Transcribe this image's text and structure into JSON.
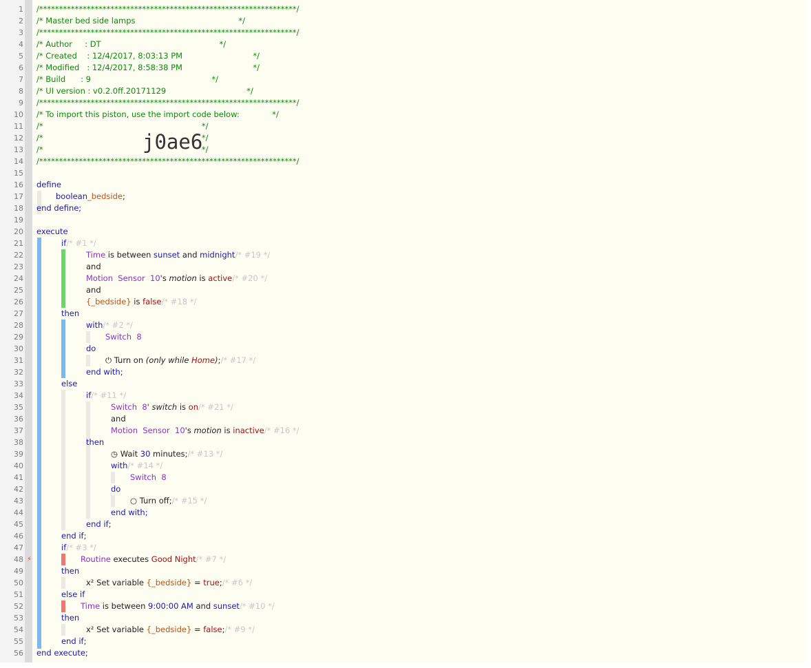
{
  "header": {
    "lines": [
      "/*****************************************************************/",
      "/* Master bed side lamps                                         */",
      "/*****************************************************************/",
      "/* Author     : DT                                               */",
      "/* Created    : 12/4/2017, 8:03:13 PM                            */",
      "/* Modified   : 12/4/2017, 8:58:38 PM                            */",
      "/* Build      : 9                                                */",
      "/* UI version : v0.2.0ff.20171129                                */",
      "/*****************************************************************/",
      "/* To import this piston, use the import code below:             */",
      "/*                                                               */",
      "/*                                                               */",
      "/*                                                               */",
      "/*****************************************************************/"
    ],
    "import_code": "j0ae6"
  },
  "line_numbers": [
    "1",
    "2",
    "3",
    "4",
    "5",
    "6",
    "7",
    "8",
    "9",
    "10",
    "11",
    "12",
    "13",
    "14",
    "15",
    "16",
    "17",
    "18",
    "19",
    "20",
    "21",
    "22",
    "23",
    "24",
    "25",
    "26",
    "27",
    "28",
    "29",
    "30",
    "31",
    "32",
    "33",
    "34",
    "35",
    "36",
    "37",
    "38",
    "39",
    "40",
    "41",
    "42",
    "43",
    "44",
    "45",
    "46",
    "47",
    "48",
    "49",
    "50",
    "51",
    "52",
    "53",
    "54",
    "55",
    "56"
  ],
  "trigger_marker": "⚡",
  "code": {
    "l16": "define",
    "l17": {
      "type": "boolean",
      "name": "_bedside",
      "semi": ";"
    },
    "l18": "end define;",
    "l20": "execute",
    "l21": {
      "kw": "if",
      "id": "/* #1 */"
    },
    "l22": {
      "a": "Time",
      "b": " is between ",
      "c": "sunset",
      "d": " and ",
      "e": "midnight",
      "id": "/* #19 */"
    },
    "l23": "and",
    "l24": {
      "a": "Motion  Sensor  10",
      "b": "'s ",
      "c": "motion",
      "d": " is ",
      "e": "active",
      "id": "/* #20 */"
    },
    "l25": "and",
    "l26": {
      "a": "{_bedside}",
      "b": " is ",
      "c": "false",
      "id": "/* #18 */"
    },
    "l27": "then",
    "l28": {
      "kw": "with",
      "id": "/* #2 */"
    },
    "l29": "Switch  8",
    "l30": "do",
    "l31": {
      "icon": "⏻",
      "a": " Turn on ",
      "b": "(only while ",
      "c": "Home",
      "d": ")",
      "e": ";",
      "id": "/* #17 */"
    },
    "l32": "end with;",
    "l33": "else",
    "l34": {
      "kw": "if",
      "id": "/* #11 */"
    },
    "l35": {
      "a": "Switch  8",
      "b": "' ",
      "c": "switch",
      "d": " is ",
      "e": "on",
      "id": "/* #21 */"
    },
    "l36": "and",
    "l37": {
      "a": "Motion  Sensor  10",
      "b": "'s ",
      "c": "motion",
      "d": " is ",
      "e": "inactive",
      "id": "/* #16 */"
    },
    "l38": "then",
    "l39": {
      "icon": "◷",
      "a": " Wait ",
      "b": "30",
      "c": " minutes;",
      "id": "/* #13 */"
    },
    "l40": {
      "kw": "with",
      "id": "/* #14 */"
    },
    "l41": "Switch  8",
    "l42": "do",
    "l43": {
      "icon": "○",
      "a": " Turn off;",
      "id": "/* #15 */"
    },
    "l44": "end with;",
    "l45": "end if;",
    "l46": "end if;",
    "l47": {
      "kw": "if",
      "id": "/* #3 */"
    },
    "l48": {
      "a": "Routine",
      "b": " executes ",
      "c": "Good Night",
      "id": "/* #7 */"
    },
    "l49": "then",
    "l50": {
      "icon": "x²",
      "a": " Set variable ",
      "b": "{_bedside}",
      "c": " = ",
      "d": "true",
      "e": ";",
      "id": "/* #6 */"
    },
    "l51": "else if",
    "l52": {
      "a": "Time",
      "b": " is between ",
      "c": "9:00:00 AM",
      "d": " and ",
      "e": "sunset",
      "id": "/* #10 */"
    },
    "l53": "then",
    "l54": {
      "icon": "x²",
      "a": " Set variable ",
      "b": "{_bedside}",
      "c": " = ",
      "d": "false",
      "e": ";",
      "id": "/* #9 */"
    },
    "l55": "end if;",
    "l56": "end execute;"
  },
  "colors": {
    "block_bar": "#7ab8ef",
    "condition_bar": "#6ed46e",
    "trigger_bar": "#f07670",
    "comment": "#0a8a0a",
    "keyword": "#1a1aa8",
    "device": "#8a33c6",
    "variable": "#b8551a",
    "value": "#a01010"
  }
}
